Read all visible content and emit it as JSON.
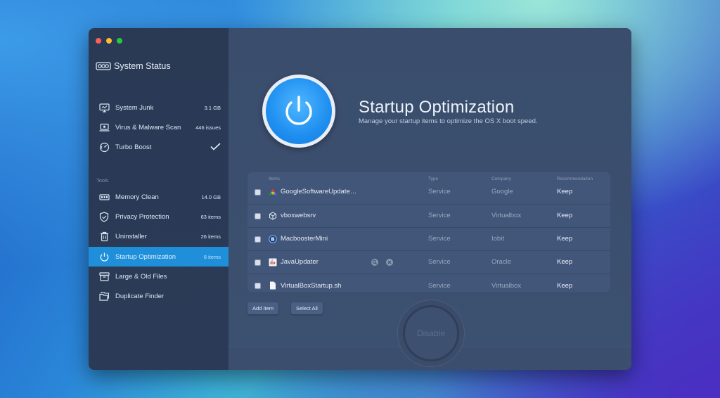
{
  "window": {
    "traffic_lights": [
      "close",
      "minimize",
      "zoom"
    ]
  },
  "sidebar": {
    "brand": "System Status",
    "items": [
      {
        "label": "System Junk",
        "value": "3.1 GB",
        "icon": "monitor-icon"
      },
      {
        "label": "Virus & Malware Scan",
        "value": "446 issues",
        "icon": "laptop-bug-icon"
      },
      {
        "label": "Turbo Boost",
        "value": "",
        "icon": "speedometer-icon",
        "status": "checkmark"
      }
    ],
    "tools_label": "Tools",
    "tools": [
      {
        "label": "Memory Clean",
        "value": "14.0 GB",
        "icon": "memory-chip-icon"
      },
      {
        "label": "Privacy Protection",
        "value": "63 items",
        "icon": "shield-icon"
      },
      {
        "label": "Uninstaller",
        "value": "26 items",
        "icon": "trash-icon"
      },
      {
        "label": "Startup Optimization",
        "value": "6 items",
        "icon": "power-icon",
        "active": true
      },
      {
        "label": "Large & Old Files",
        "value": "",
        "icon": "archive-box-icon"
      },
      {
        "label": "Duplicate Finder",
        "value": "",
        "icon": "duplicate-folder-icon"
      }
    ]
  },
  "main": {
    "title": "Startup Optimization",
    "subtitle": "Manage your startup items to optimize the OS X boot speed.",
    "table": {
      "headers": {
        "items": "Items",
        "type": "Type",
        "company": "Company",
        "recommendation": "Recommendation"
      },
      "rows": [
        {
          "name": "GoogleSoftwareUpdate…",
          "type": "Service",
          "company": "Google",
          "recommendation": "Keep",
          "icon": "google-update-icon"
        },
        {
          "name": "vboxwebsrv",
          "type": "Service",
          "company": "Virtualbox",
          "recommendation": "Keep",
          "icon": "cube-icon"
        },
        {
          "name": "MacboosterMini",
          "type": "Service",
          "company": "Iobit",
          "recommendation": "Keep",
          "icon": "macbooster-icon"
        },
        {
          "name": "JavaUpdater",
          "type": "Service",
          "company": "Oracle",
          "recommendation": "Keep",
          "icon": "java-icon"
        },
        {
          "name": "VirtualBoxStartup.sh",
          "type": "Service",
          "company": "Virtualbox",
          "recommendation": "Keep",
          "icon": "document-icon"
        }
      ]
    },
    "add_item_label": "Add Item",
    "select_all_label": "Select All",
    "disable_label": "Disable"
  },
  "colors": {
    "sidebar_bg": "#2a3a55",
    "main_bg": "#3a4d6c",
    "active_item": "#1f8fd9",
    "accent_blue": "#1e8ff0"
  }
}
